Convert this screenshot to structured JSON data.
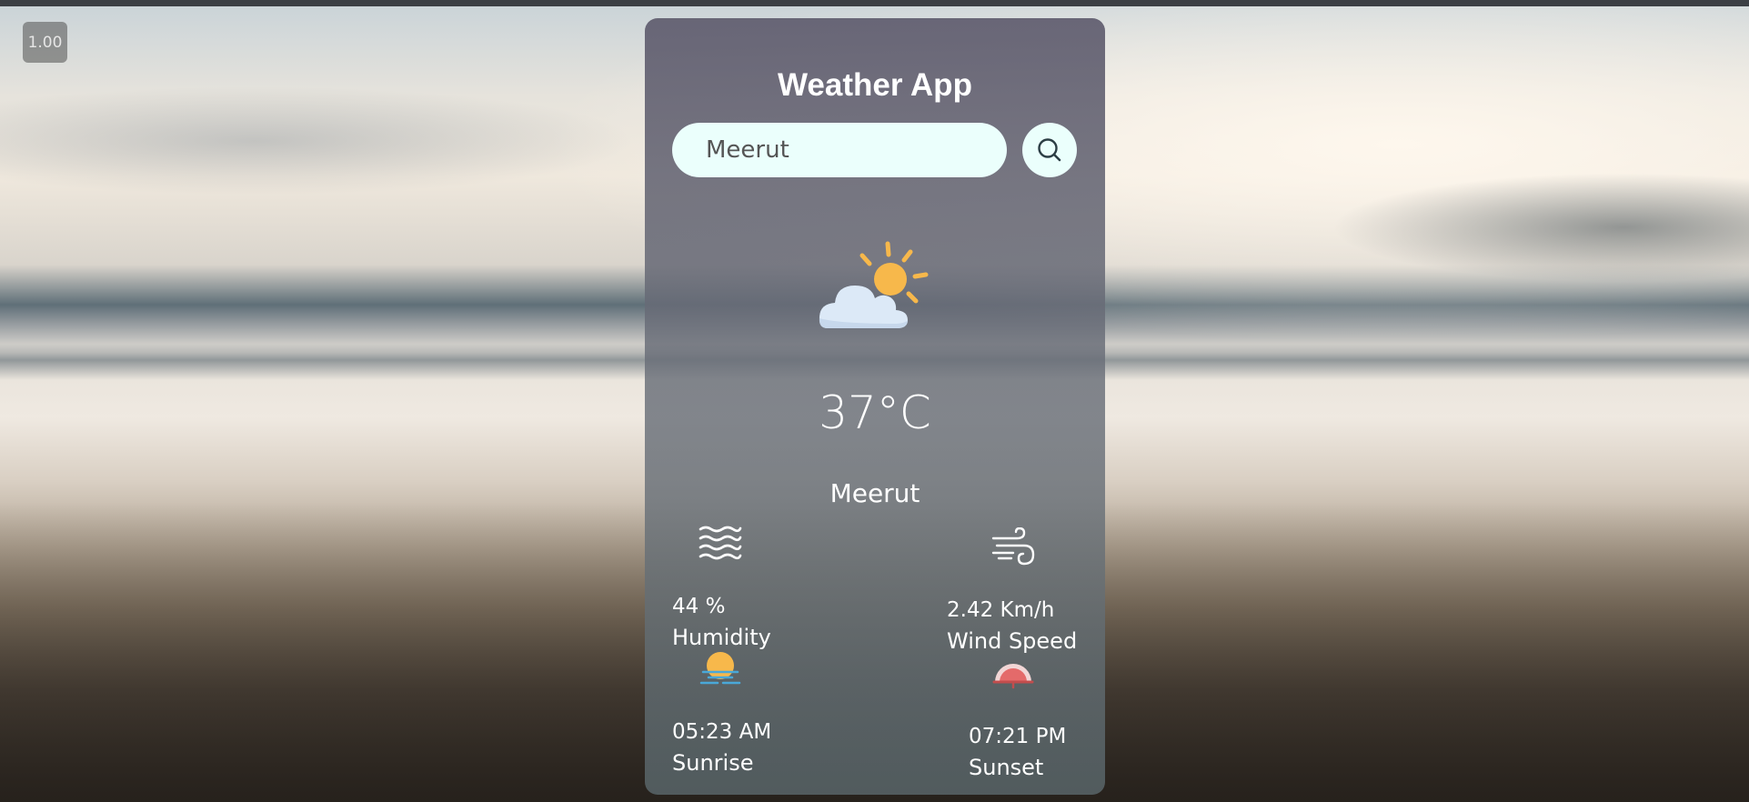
{
  "zoom": "1.00",
  "app": {
    "title": "Weather App"
  },
  "search": {
    "value": "Meerut",
    "placeholder": "Meerut",
    "icon": "search-icon"
  },
  "current": {
    "condition_icon": "partly-cloudy-icon",
    "temperature": "37°C",
    "city": "Meerut"
  },
  "details": {
    "humidity": {
      "icon": "humidity-waves-icon",
      "value": "44 %",
      "label": "Humidity"
    },
    "wind": {
      "icon": "wind-icon",
      "value": "2.42 Km/h",
      "label": "Wind Speed"
    },
    "sunrise": {
      "icon": "sunrise-icon",
      "value": "05:23 AM",
      "label": "Sunrise"
    },
    "sunset": {
      "icon": "sunset-icon",
      "value": "07:21 PM",
      "label": "Sunset"
    }
  },
  "colors": {
    "input_bg": "#ebfffc",
    "text": "#ffffff",
    "sun": "#f7b84b",
    "cloud": "#dce9f7"
  }
}
